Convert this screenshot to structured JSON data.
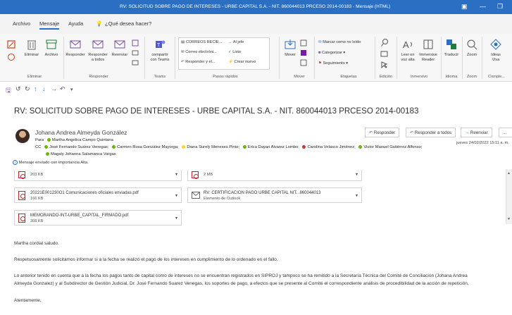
{
  "window": {
    "title": "RV: SOLICITUD SOBRE PAGO DE INTERESES - URBE CAPITAL S.A. - NIT. 860044013 PRCESO 2014-00183 - Mensaje (HTML)"
  },
  "menu": {
    "tabs": [
      "Archivo",
      "Mensaje",
      "Ayuda"
    ],
    "search_placeholder": "¿Qué desea hacer?"
  },
  "ribbon": {
    "eliminar": {
      "label1": "Eliminar",
      "label2": "Archivo",
      "group": "Eliminar"
    },
    "responder": {
      "r": "Responder",
      "rt1": "Responder",
      "rt2": "a todos",
      "rr": "Reenviar",
      "group": "Responder"
    },
    "teams": {
      "l1": "compartir",
      "l2": "con Teams",
      "group": "Teams"
    },
    "pasos": {
      "items": [
        "CORREOS RECIE...",
        "Correo electróni...",
        "Responder y el...",
        "Al jefe",
        "Listo",
        "Crear nuevo"
      ],
      "group": "Pasos rápidos"
    },
    "mover": {
      "label": "Mover",
      "group": "Mover"
    },
    "etiquetas": {
      "items": [
        "Marcar como no leído",
        "Categorizar",
        "Seguimiento"
      ],
      "group": "Etiquetas"
    },
    "edicion": {
      "group": "Edición"
    },
    "inmersivo": {
      "l1a": "Leer en",
      "l1b": "voz alta",
      "l2a": "Immersive",
      "l2b": "Reader",
      "group": "Inmersivo"
    },
    "idioma": {
      "label": "Traducir",
      "group": "Idioma"
    },
    "zoom": {
      "label": "Zoom",
      "group": "Zoom"
    },
    "complementos": {
      "l1": "Ideas",
      "l2": "Viva",
      "group": "Comple..."
    }
  },
  "message": {
    "subject": "RV: SOLICITUD SOBRE PAGO DE INTERESES - URBE CAPITAL S.A. - NIT. 860044013 PRCESO 2014-00183",
    "sender": "Johana Andrea Almeyda González",
    "to_label": "Para",
    "to": "Martha Angelica Campo Quintana",
    "cc_label": "CC",
    "cc": [
      {
        "name": "José Fernando Suárez Venegas;",
        "status": "green"
      },
      {
        "name": "Carmen Rosa González Mayorga;",
        "status": "green"
      },
      {
        "name": "Diana Surely Meneses Pinto;",
        "status": "yellow"
      },
      {
        "name": "Erica Dayan Alvarez Lombo;",
        "status": "green"
      },
      {
        "name": "Carolina Velasco Jiménez;",
        "status": "red"
      },
      {
        "name": "Victor Manuel Gutiérrez Alfonso;",
        "status": "green"
      }
    ],
    "cc_extra": "Magaly Johanna Salamanca Vargas",
    "importance": "Mensaje enviado con importancia Alta.",
    "date": "jueves 24/02/2022 15:11 a. m.",
    "actions": {
      "reply": "Responder",
      "reply_all": "Responder a todos",
      "forward": "Reenviar",
      "more": "..."
    }
  },
  "attachments": [
    {
      "name": "",
      "size": "203 KB"
    },
    {
      "name": "",
      "size": "2 MB"
    },
    {
      "name": "20221E001230O1 Comunicaciones oficiales enviadas.pdf",
      "size": "166 KB"
    },
    {
      "name": "RV: CERTIFICACION PAGO URBE CAPITAL NIT. .860044013",
      "size": "Elemento de Outlook"
    },
    {
      "name": "MEMORANDO-INT-URBE_CAPITAL_FIRMADO.pdf",
      "size": "208 KB"
    }
  ],
  "body": {
    "p1": "Martha cordial saludo.",
    "p2": "Respetuosamente solicitamos informar si a la fecha se realizó el pago de los intereses en cumplimiento de lo ordenado en el fallo.",
    "p3a": "Lo anterior tenido en cuenta que a la fecha los pagos tanto de capital como de intereses no se encuentran registrados en SIPROJ y tampoco se ha remitido a la Secretaría Técnica del Comité de Conciliación (Johana Andrea",
    "p3b": "Almeyda Gonzalez) y al Subdirector de Gestión Judicial, Dr. José Fernando Suarez Venegas, los soportes de pago, a efectos que se presente al Comité el correspondiente análisis de procedibilidad de la acción de repetición.",
    "p4": "Atentamente,"
  },
  "colors": {
    "titlebar": "#2b6fc3",
    "accent": "#2b6fc3",
    "pdf": "#c4262e"
  }
}
